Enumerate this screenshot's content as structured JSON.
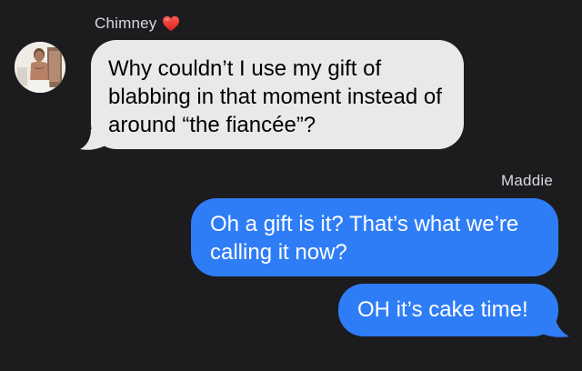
{
  "conversation": {
    "contact": {
      "name": "Chimney",
      "name_emoji": "red-heart",
      "avatar": "contact-photo"
    },
    "me": {
      "name": "Maddie"
    },
    "messages": [
      {
        "direction": "incoming",
        "sender": "Chimney",
        "text": "Why couldn’t I use my gift of blabbing in that moment instead of around “the fiancée”?"
      },
      {
        "direction": "outgoing",
        "sender": "Maddie",
        "text": "Oh a gift is it? That’s what we’re calling it now?"
      },
      {
        "direction": "outgoing",
        "sender": "Maddie",
        "text": "OH it’s cake time!"
      }
    ]
  },
  "colors": {
    "background": "#1c1c1e",
    "incoming_bubble": "#e9e9eb",
    "outgoing_bubble": "#2f7df6",
    "heart": "#e0342f"
  }
}
